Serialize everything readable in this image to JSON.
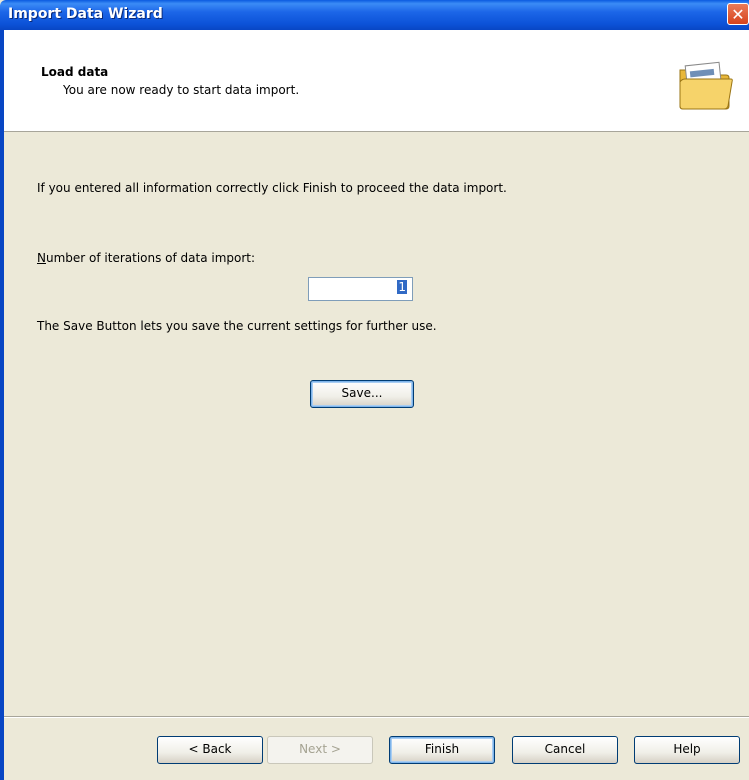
{
  "window": {
    "title": "Import Data Wizard",
    "close_glyph": "✕"
  },
  "header": {
    "title": "Load data",
    "subtitle": "You are now ready to start data import.",
    "icon": "folder-icon"
  },
  "content": {
    "info_text": "If you entered all information correctly click Finish to proceed the data import.",
    "iterations_label": "Number of iterations of data import:",
    "iterations_value": "1",
    "save_text": "The Save Button lets you save the current settings for further use.",
    "save_label": "Save..."
  },
  "footer": {
    "back_label": "< Back",
    "next_label": "Next >",
    "finish_label": "Finish",
    "cancel_label": "Cancel",
    "help_label": "Help"
  },
  "colors": {
    "titlebar": "#0c52d8",
    "dialog_bg": "#ece9d8",
    "header_bg": "#ffffff",
    "selection": "#316ac5"
  }
}
